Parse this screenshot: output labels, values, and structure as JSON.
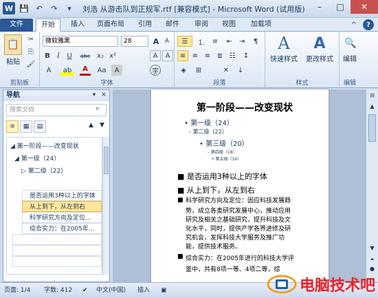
{
  "window": {
    "title": "刘浩 从游击队到正规军.rtf [兼容模式] - Microsoft Word (试用版)",
    "minimize": "–",
    "maximize": "□",
    "close": "✕"
  },
  "qat": {
    "word_icon": "W",
    "save_icon": "💾",
    "undo_icon": "↶",
    "redo_icon": "↷",
    "customize_icon": "▾"
  },
  "tabs": {
    "file": "文件",
    "home": "开始",
    "insert": "插入",
    "layout": "页面布局",
    "references": "引用",
    "mailings": "邮件",
    "review": "审阅",
    "view": "视图",
    "addins": "加载项"
  },
  "ribbon": {
    "clipboard": {
      "label": "剪贴板",
      "paste": "粘贴"
    },
    "font": {
      "label": "字体",
      "name": "微软雅黑",
      "size": "28",
      "grow": "A",
      "shrink": "A",
      "clear": "A",
      "bold": "B",
      "italic": "I",
      "underline": "U",
      "strike": "abc",
      "sub": "x₂",
      "sup": "x²",
      "case": "Aa",
      "highlight": "ab",
      "color": "A",
      "phonetic": "A",
      "enclose": "字"
    },
    "paragraph": {
      "label": "段落"
    },
    "styles": {
      "label": "样式",
      "quick": "快速样式",
      "change": "更改样式"
    },
    "editing": {
      "label": "编辑",
      "title": "编辑"
    }
  },
  "nav": {
    "title": "导航",
    "close": "×",
    "search_placeholder": "搜索文档",
    "items": [
      "第一阶段——改变现状",
      "第一级（24）",
      "第二级（22）",
      "",
      "是否运用3种以上的字体",
      "从上到下，从左到右",
      "科学研究方向及定位...",
      "综合实力：在2005年..."
    ]
  },
  "doc": {
    "heading": "第一阶段——改变现状",
    "l1": "第一级（24）",
    "l2": "第二级（22）",
    "l3": "第三级（20）",
    "l4": "第四级（18）",
    "l5": "第五级（16）",
    "b1": "是否运用3种以上的字体",
    "b2": "从上到下，从左到右",
    "b3": [
      "科学研究方向及定位：因应科技发展趋",
      "势，成立各类研究发展中心，推动应用",
      "研究及相关之基础研究，提升科技及文",
      "化水平，同时，提供产学各界进修及研",
      "究机会，发挥科技大学服务及推广功",
      "能，提供技术服务。"
    ],
    "b4": [
      "综合实力：在2005年进行的科技大学评",
      "鉴中，共有8项一等、4项二等，综"
    ]
  },
  "status": {
    "page": "页面: 1/4",
    "words": "字数: 412",
    "lang": "中文(中国)",
    "mode": "插入"
  },
  "watermark": {
    "text": "电脑技术吧"
  },
  "colors": {
    "accent": "#2b5797",
    "highlight": "#ffe79a",
    "watermark": "#e8232a"
  }
}
